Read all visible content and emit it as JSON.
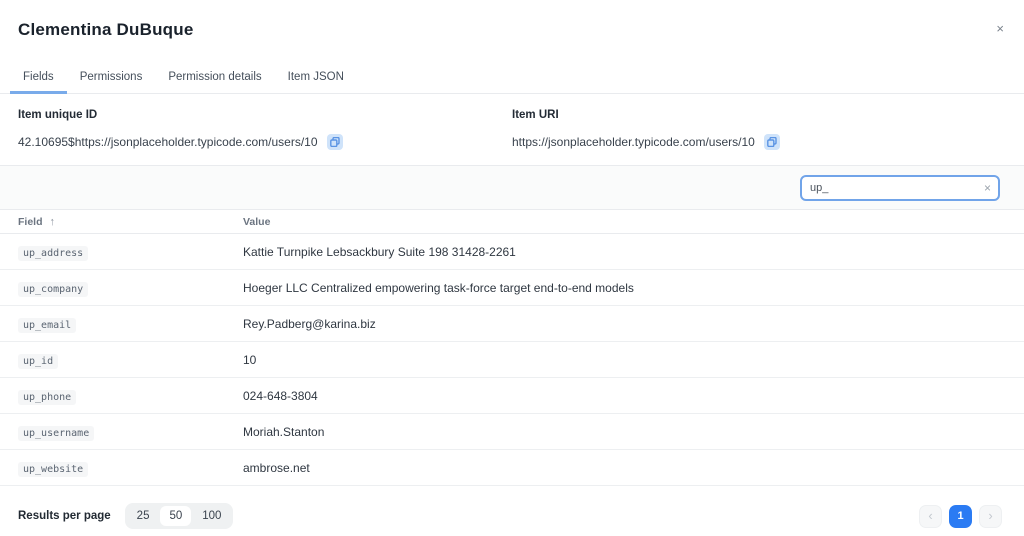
{
  "header": {
    "title": "Clementina DuBuque",
    "close_icon": "×"
  },
  "tabs": [
    {
      "label": "Fields",
      "active": true
    },
    {
      "label": "Permissions",
      "active": false
    },
    {
      "label": "Permission details",
      "active": false
    },
    {
      "label": "Item JSON",
      "active": false
    }
  ],
  "info": {
    "unique_id": {
      "label": "Item unique ID",
      "value": "42.10695$https://jsonplaceholder.typicode.com/users/10",
      "copy_icon": "copy-icon"
    },
    "uri": {
      "label": "Item URI",
      "value": "https://jsonplaceholder.typicode.com/users/10",
      "copy_icon": "copy-icon"
    }
  },
  "search": {
    "value": "up_",
    "clear_icon": "×"
  },
  "table": {
    "columns": {
      "field": "Field",
      "sort_icon": "↑",
      "value": "Value"
    },
    "rows": [
      {
        "field": "up_address",
        "value": "Kattie Turnpike Lebsackbury Suite 198 31428-2261"
      },
      {
        "field": "up_company",
        "value": "Hoeger LLC Centralized empowering task-force target end-to-end models"
      },
      {
        "field": "up_email",
        "value": "Rey.Padberg@karina.biz"
      },
      {
        "field": "up_id",
        "value": "10"
      },
      {
        "field": "up_phone",
        "value": "024-648-3804"
      },
      {
        "field": "up_username",
        "value": "Moriah.Stanton"
      },
      {
        "field": "up_website",
        "value": "ambrose.net"
      }
    ]
  },
  "footer": {
    "results_per_page_label": "Results per page",
    "page_size_options": [
      "25",
      "50",
      "100"
    ],
    "selected_page_size": "50",
    "pagination": {
      "prev_icon": "‹",
      "page": "1",
      "next_icon": "›"
    }
  },
  "colors": {
    "accent_blue": "#2b7bf3",
    "tab_underline": "#79abea",
    "search_border": "#71a4e9",
    "copy_icon_blue": "#5b94e4"
  }
}
